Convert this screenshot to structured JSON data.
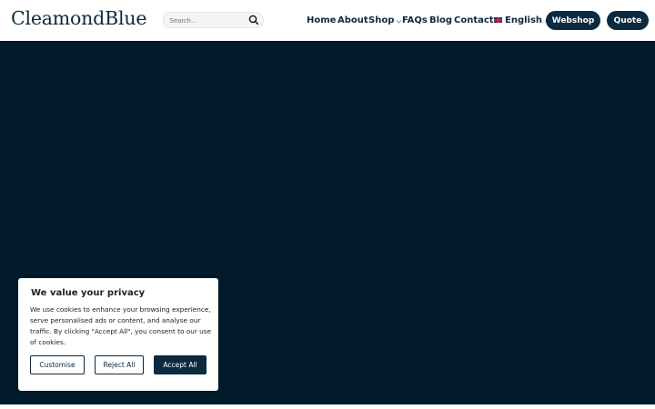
{
  "brand": {
    "logo_text": "CleamondBlue"
  },
  "search": {
    "placeholder": "Search…",
    "value": "",
    "icon": "search-icon"
  },
  "nav": {
    "home": "Home",
    "about": "About",
    "shop": "Shop",
    "faqs": "FAQs",
    "blog": "Blog",
    "contact": "Contact",
    "language": "English"
  },
  "actions": {
    "webshop": "Webshop",
    "quote": "Quote"
  },
  "cookie_banner": {
    "title": "We value your privacy",
    "body": "We use cookies to enhance your browsing experience, serve personalised ads or content, and analyse our traffic. By clicking \"Accept All\", you consent to our use of cookies.",
    "customise": "Customise",
    "reject": "Reject All",
    "accept": "Accept All"
  },
  "colors": {
    "brand_navy": "#0b2a3f",
    "hero_background": "#011b2a",
    "header_background": "#ffffff"
  }
}
